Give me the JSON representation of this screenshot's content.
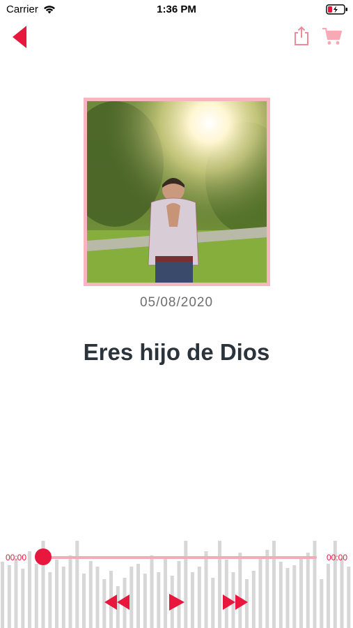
{
  "status_bar": {
    "carrier": "Carrier",
    "time": "1:36 PM"
  },
  "nav": {
    "back_icon": "back-triangle-icon",
    "share_icon": "share-icon",
    "cart_icon": "cart-icon"
  },
  "episode": {
    "date": "05/08/2020",
    "title": "Eres hijo de Dios"
  },
  "player": {
    "elapsed": "00:00",
    "total": "00:00",
    "progress": 0
  },
  "colors": {
    "accent": "#e8173d",
    "accent_light": "#f5aab5",
    "frame": "#f7b6bf",
    "title": "#2b333b",
    "date": "#6e6e6e"
  }
}
